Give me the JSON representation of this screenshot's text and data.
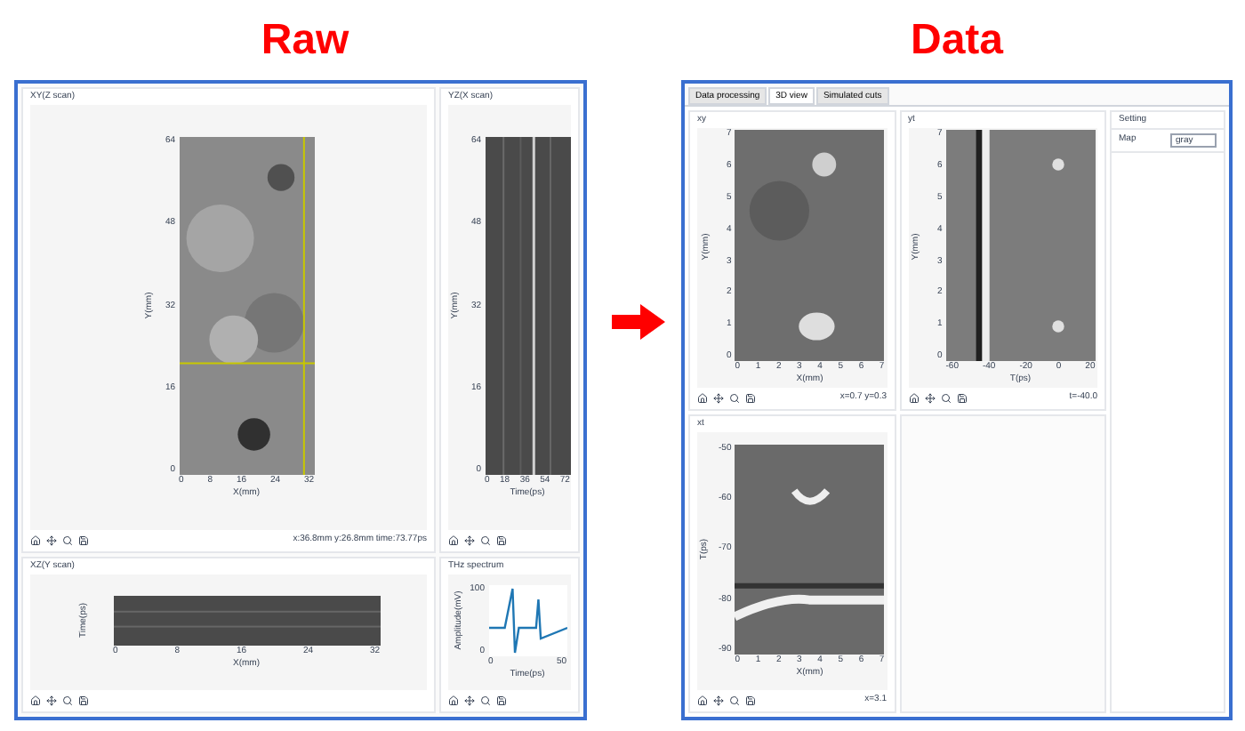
{
  "headings": [
    {
      "text": "Raw"
    },
    {
      "text": "Data"
    }
  ],
  "raw": {
    "panels": [
      {
        "title": "XY(Z scan)",
        "ylabel": "Y(mm)",
        "xlabel": "X(mm)",
        "yticks": [
          "64",
          "48",
          "32",
          "16",
          "0"
        ],
        "xticks": [
          "0",
          "8",
          "16",
          "24",
          "32"
        ],
        "readout": "x:36.8mm y:26.8mm time:73.77ps"
      },
      {
        "title": "YZ(X scan)",
        "ylabel": "Y(mm)",
        "xlabel": "Time(ps)",
        "yticks": [
          "64",
          "48",
          "32",
          "16",
          "0"
        ],
        "xticks": [
          "0",
          "18",
          "36",
          "54",
          "72"
        ]
      },
      {
        "title": "XZ(Y scan)",
        "ylabel": "Time(ps)",
        "xlabel": "X(mm)",
        "xticks": [
          "0",
          "8",
          "16",
          "24",
          "32"
        ]
      },
      {
        "title": "THz spectrum",
        "ylabel": "Amplitude(mV)",
        "xlabel": "Time(ps)",
        "yticks": [
          "100",
          "0"
        ],
        "xticks": [
          "0",
          "50"
        ]
      }
    ]
  },
  "data": {
    "tabs": [
      {
        "label": "Data processing",
        "selected": false
      },
      {
        "label": "3D view",
        "selected": true
      },
      {
        "label": "Simulated cuts",
        "selected": false
      }
    ],
    "panels": [
      {
        "title": "xy",
        "ylabel": "Y(mm)",
        "xlabel": "X(mm)",
        "yticks": [
          "7",
          "6",
          "5",
          "4",
          "3",
          "2",
          "1",
          "0"
        ],
        "xticks": [
          "0",
          "1",
          "2",
          "3",
          "4",
          "5",
          "6",
          "7"
        ],
        "readout": "x=0.7 y=0.3"
      },
      {
        "title": "yt",
        "ylabel": "Y(mm)",
        "xlabel": "T(ps)",
        "yticks": [
          "7",
          "6",
          "5",
          "4",
          "3",
          "2",
          "1",
          "0"
        ],
        "xticks": [
          "-60",
          "-40",
          "-20",
          "0",
          "20"
        ],
        "readout": "t=-40.0"
      },
      {
        "title": "xt",
        "ylabel": "T(ps)",
        "xlabel": "X(mm)",
        "yticks": [
          "-50",
          "-60",
          "-70",
          "-80",
          "-90"
        ],
        "xticks": [
          "0",
          "1",
          "2",
          "3",
          "4",
          "5",
          "6",
          "7"
        ],
        "readout": "x=3.1"
      }
    ],
    "setting": {
      "title": "Setting",
      "label": "Map",
      "value": "gray"
    }
  }
}
